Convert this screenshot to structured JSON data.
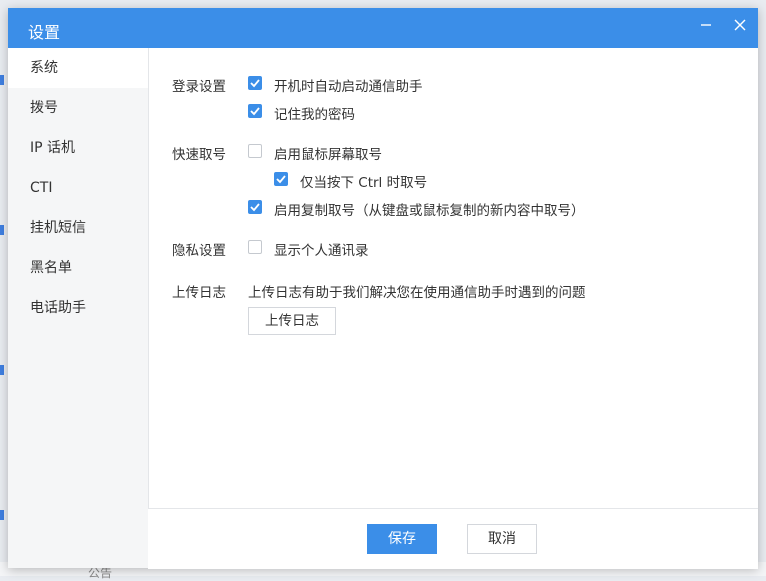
{
  "dialog": {
    "title": "设置",
    "minimize_icon": "minimize-icon",
    "close_icon": "close-icon"
  },
  "sidebar": {
    "items": [
      {
        "label": "系统",
        "active": true
      },
      {
        "label": "拨号",
        "active": false
      },
      {
        "label": "IP 话机",
        "active": false
      },
      {
        "label": "CTI",
        "active": false
      },
      {
        "label": "挂机短信",
        "active": false
      },
      {
        "label": "黑名单",
        "active": false
      },
      {
        "label": "电话助手",
        "active": false
      }
    ]
  },
  "sections": {
    "login": {
      "label": "登录设置",
      "options": [
        {
          "label": "开机时自动启动通信助手",
          "checked": true
        },
        {
          "label": "记住我的密码",
          "checked": true
        }
      ]
    },
    "quick_dial": {
      "label": "快速取号",
      "options": [
        {
          "label": "启用鼠标屏幕取号",
          "checked": false
        },
        {
          "label": "仅当按下 Ctrl 时取号",
          "checked": true
        },
        {
          "label": "启用复制取号（从键盘或鼠标复制的新内容中取号）",
          "checked": true
        }
      ]
    },
    "privacy": {
      "label": "隐私设置",
      "options": [
        {
          "label": "显示个人通讯录",
          "checked": false
        }
      ]
    },
    "log": {
      "label": "上传日志",
      "description": "上传日志有助于我们解决您在使用通信助手时遇到的问题",
      "button_label": "上传日志"
    }
  },
  "footer": {
    "save_label": "保存",
    "cancel_label": "取消"
  },
  "background": {
    "footer_text": "公告"
  },
  "colors": {
    "accent": "#3b8ee8",
    "sidebar_bg": "#f5f6f7"
  }
}
